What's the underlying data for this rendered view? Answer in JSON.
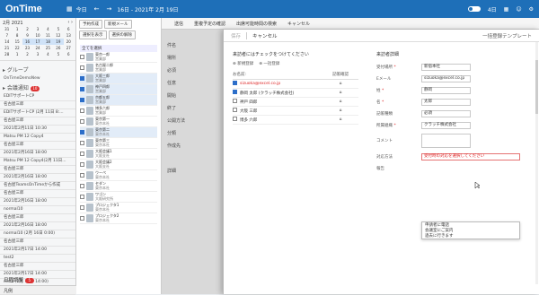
{
  "app": {
    "title": "OnTime",
    "colors": {
      "brand": "#1e6fb8",
      "error": "#d22222",
      "badge": "#dd3333"
    }
  },
  "topbar": {
    "today_label": "今日",
    "date_range": "16日 - 2021年 2月 19日",
    "view_label": "4日",
    "icons": [
      "calendar-icon",
      "grid-icon",
      "arrow-left-icon",
      "arrow-right-icon",
      "user-icon",
      "gear-icon"
    ]
  },
  "calendar": {
    "month_label": "2月 2021",
    "days": [
      "31",
      "1",
      "2",
      "3",
      "4",
      "5",
      "6",
      "7",
      "8",
      "9",
      "10",
      "11",
      "12",
      "13",
      "14",
      "15",
      "16",
      "17",
      "18",
      "19",
      "20",
      "21",
      "22",
      "23",
      "24",
      "25",
      "26",
      "27",
      "28",
      "1",
      "2",
      "3",
      "4",
      "5",
      "6"
    ],
    "highlighted": [
      "16",
      "17",
      "18",
      "19"
    ]
  },
  "sidebar": {
    "group_section": "グループ",
    "tree": [
      "OnTimeDemoNew"
    ],
    "notice_section": "会議通知",
    "notice_badge": "10",
    "notices": [
      "EDITサポートCP",
      "名古屋三郎",
      "EDITサポートCP (2月 11日 8:...",
      "名古屋三郎",
      "2021年2月11日 10:30",
      "Matsu PM 12 Copy4",
      "名古屋三郎",
      "2021年2月16日 18:00",
      "Matsu PM 12 Copy4(2月 11日...",
      "名古屋三郎",
      "2021年2月16日 18:00",
      "名古屋TeamsOnTimeから作成",
      "名古屋三郎",
      "2021年2月16日 18:00",
      "normal10",
      "名古屋三郎",
      "2021年2月16日 18:00",
      "normal10 (2月 16日 0:00)",
      "名古屋三郎",
      "2021年2月17日 14:00",
      "test2",
      "名古屋三郎",
      "2021年2月17日 14:00",
      "rest2 (2月 17日 14:00)",
      "名古屋三郎"
    ],
    "bottom_section": "日程調整",
    "bottom_badge": "5",
    "footer_label": "凡例"
  },
  "members": {
    "actions": [
      "予約作成",
      "新規メール",
      "選択を表示",
      "選択の解除"
    ],
    "all_select": "全てを選択",
    "list": [
      {
        "name": "東京一郎",
        "dept": "営業部",
        "checked": false
      },
      {
        "name": "名古屋二郎",
        "dept": "営業部",
        "checked": false
      },
      {
        "name": "大阪三郎",
        "dept": "営業部",
        "checked": true
      },
      {
        "name": "神戸四郎",
        "dept": "営業部",
        "checked": true
      },
      {
        "name": "京都五郎",
        "dept": "営業部",
        "checked": true
      },
      {
        "name": "博多六郎",
        "dept": "営業部",
        "checked": false
      },
      {
        "name": "東京第一",
        "dept": "東京本社",
        "checked": false
      },
      {
        "name": "東京第二",
        "dept": "東京本社",
        "checked": true
      },
      {
        "name": "東京第三",
        "dept": "東京本社",
        "checked": false
      },
      {
        "name": "大阪会議1",
        "dept": "大阪支社",
        "checked": false
      },
      {
        "name": "大阪会議2",
        "dept": "大阪支社",
        "checked": false
      },
      {
        "name": "ウーペ",
        "dept": "東京本社",
        "checked": false
      },
      {
        "name": "セダン",
        "dept": "東京本社",
        "checked": false
      },
      {
        "name": "ワゴン",
        "dept": "大阪研究所",
        "checked": false
      },
      {
        "name": "プロジェクタ1",
        "dept": "東京本社",
        "checked": false
      },
      {
        "name": "プロジェクタ2",
        "dept": "東京本社",
        "checked": false
      }
    ]
  },
  "bg_panel": {
    "menu": [
      "送信",
      "重複予定の確認",
      "出席可能時間の検索",
      "キャンセル"
    ],
    "side_fields": [
      "件名",
      "場所",
      "必須",
      "任意",
      "開始",
      "終了",
      "公開方法",
      "分類",
      "作成先",
      "",
      "詳細"
    ]
  },
  "modal": {
    "save_label": "保存",
    "cancel_label": "キャンセル",
    "template_label": "一括登録テンプレート",
    "left_title": "来訪者にはチェックをつけてください",
    "opt_new": "新規登録",
    "opt_bulk": "一括登録",
    "col_name": "お名前:",
    "col_attend": "記帳確認",
    "rows": [
      {
        "name": "sizuoka@excel.co.jp",
        "checked": true,
        "red": true
      },
      {
        "name": "静岡 太郎 (クラッチ株式会社)",
        "checked": true,
        "red": false
      },
      {
        "name": "神戸 四郎",
        "checked": false,
        "red": false
      },
      {
        "name": "大阪 三郎",
        "checked": false,
        "red": false
      },
      {
        "name": "博多 六郎",
        "checked": false,
        "red": false
      }
    ],
    "right_title": "来訪者詳細",
    "fields": [
      {
        "label": "受付場所",
        "value": "新宿本社",
        "required": true
      },
      {
        "label": "Eメール",
        "value": "sizuoka@excel.co.jp",
        "required": false
      },
      {
        "label": "姓",
        "value": "静岡",
        "required": true
      },
      {
        "label": "名",
        "value": "太郎",
        "required": true
      },
      {
        "label": "記帳種類",
        "value": "必須",
        "required": false
      },
      {
        "label": "所属組織",
        "value": "クラッチ株式会社",
        "required": true
      },
      {
        "label": "コメント",
        "value": "",
        "required": false
      }
    ],
    "response_label": "対応方法",
    "response_placeholder": "受付時の対応を選択してください",
    "attachment_label": "報告",
    "dropdown_options": [
      "申請者に電話",
      "会議室にご案内",
      "過去に行きます"
    ]
  }
}
